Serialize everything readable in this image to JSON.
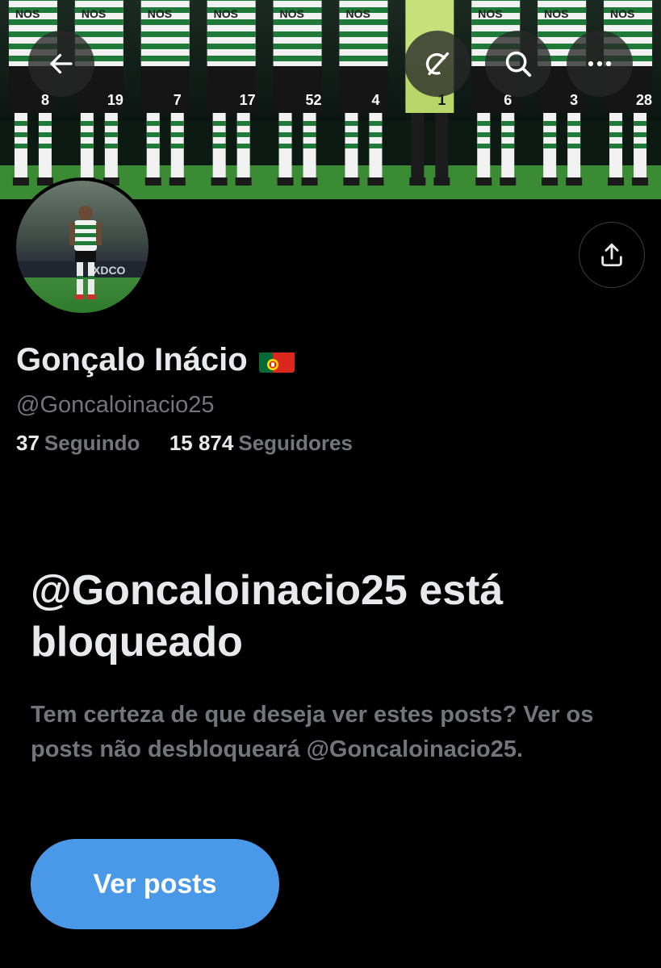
{
  "header": {
    "back_icon": "arrow-left-icon",
    "grok_icon": "grok-slash-icon",
    "search_icon": "search-icon",
    "more_icon": "more-horizontal-icon"
  },
  "banner": {
    "sponsor_text": "NOS",
    "jersey_numbers": [
      "8",
      "19",
      "7",
      "17",
      "52",
      "4",
      "1",
      "6",
      "3",
      "28"
    ]
  },
  "profile": {
    "name": "Gonçalo Inácio",
    "flag": "Portugal flag",
    "handle": "@Goncaloinacio25",
    "following_count": "37",
    "following_label": "Seguindo",
    "followers_count": "15 874",
    "followers_label": "Seguidores",
    "share_icon": "share-icon"
  },
  "blocked": {
    "title": "@Goncaloinacio25 está bloqueado",
    "description": "Tem certeza de que deseja ver estes posts? Ver os posts não desbloqueará @Goncaloinacio25.",
    "button_label": "Ver posts"
  },
  "colors": {
    "background": "#000000",
    "text_primary": "#e7e9ea",
    "text_secondary": "#71767b",
    "accent_button": "#4a99e9",
    "jersey_green": "#1f7a3a"
  }
}
